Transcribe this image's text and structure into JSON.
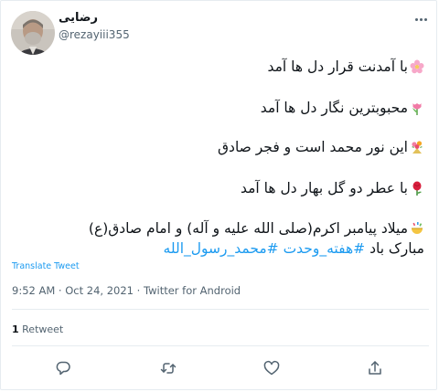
{
  "user": {
    "display_name": "رضایی",
    "handle": "@rezayiii355"
  },
  "tweet": {
    "line1": "با آمدنت قرار دل ها آمد",
    "line2": "محبوبترین نگار دل ها آمد",
    "line3": "این نور محمد است و فجر صادق",
    "line4": "با عطر دو گل بهار دل ها آمد",
    "line5": "میلاد پیامبر اکرم(صلی الله علیه و آله) و امام صادق(ع)",
    "line6_text": "مبارک باد",
    "hashtag1": "#هفته_وحدت",
    "hashtag2": "#محمد_رسول_الله",
    "emojis": [
      "cherry-blossom-icon",
      "tulip-icon",
      "bouquet-icon",
      "rose-icon",
      "confetti-ball-icon"
    ]
  },
  "translate_label": "Translate Tweet",
  "meta": {
    "time": "9:52 AM",
    "sep1": " · ",
    "date": "Oct 24, 2021",
    "sep2": " · ",
    "source": "Twitter for Android"
  },
  "stats": {
    "retweet_count": "1",
    "retweet_label": " Retweet"
  },
  "colors": {
    "link": "#1d9bf0",
    "secondary_text": "#536471",
    "border": "#e6ecf0"
  }
}
